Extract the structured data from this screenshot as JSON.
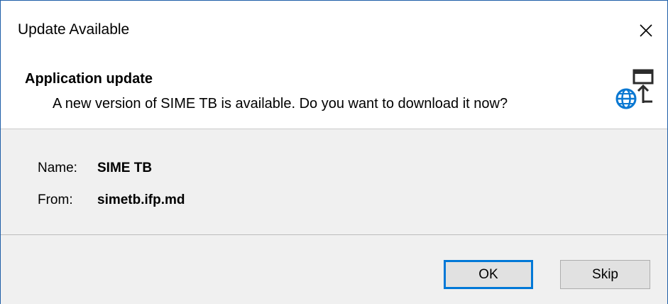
{
  "window": {
    "title": "Update Available",
    "close_icon": "close-icon"
  },
  "header": {
    "title": "Application update",
    "message": "A new version of SIME TB is available. Do you want to download it now?",
    "icon": "globe-update-icon"
  },
  "details": {
    "name_label": "Name:",
    "name_value": "SIME TB",
    "from_label": "From:",
    "from_value": "simetb.ifp.md"
  },
  "buttons": {
    "ok_label": "OK",
    "skip_label": "Skip"
  },
  "colors": {
    "accent": "#0078d7",
    "panel_bg": "#f0f0f0",
    "button_bg": "#e1e1e1"
  }
}
